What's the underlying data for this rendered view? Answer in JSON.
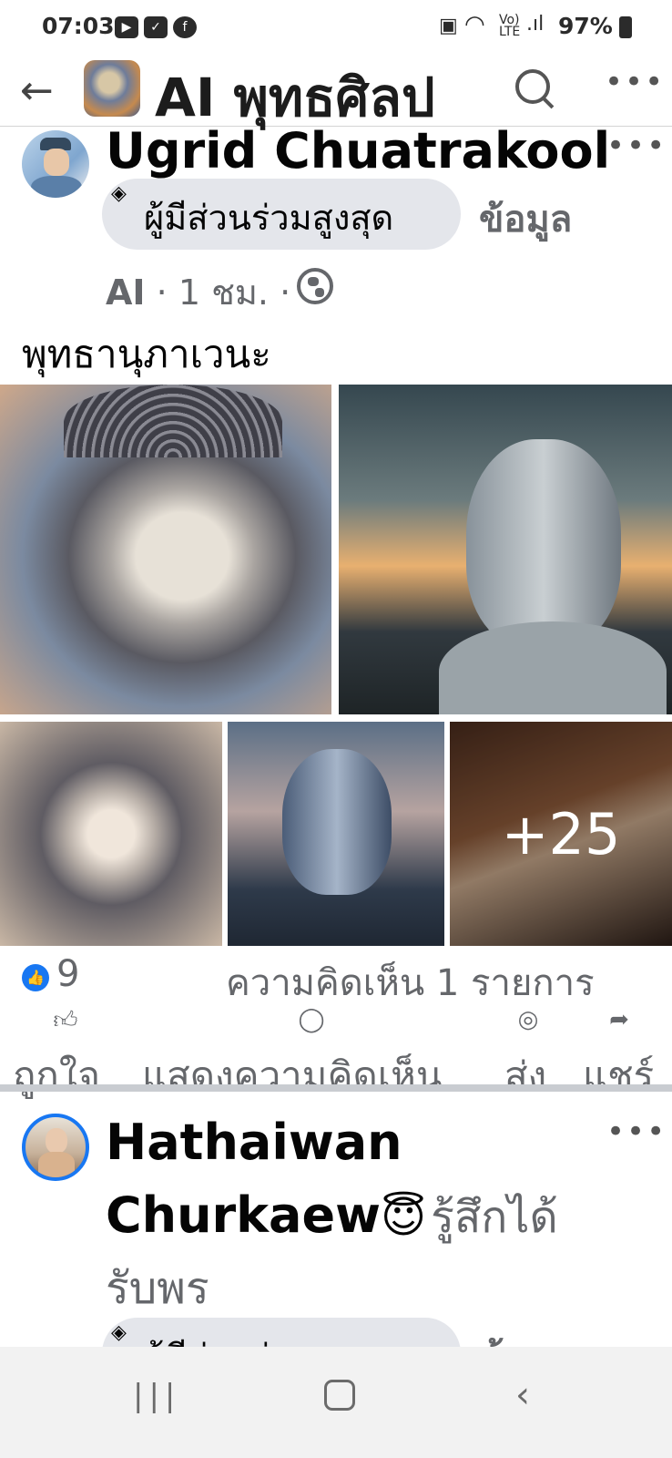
{
  "status_bar": {
    "time": "07:03",
    "battery": "97%"
  },
  "header": {
    "title": "AI พุทธศิลป"
  },
  "post1": {
    "author": "Ugrid Chuatrakool",
    "badge": "ผู้มีส่วนร่วมสูงสุด",
    "info_link": "ข้อมูล",
    "meta_tag": "AI",
    "meta_time": "1 ชม.",
    "caption": "พุทธานุภาเวนะ",
    "more_photos": "+25",
    "reactions_count": "9",
    "comments_count": "ความคิดเห็น 1 รายการ",
    "actions": {
      "like": "ถูกใจ",
      "comment": "แสดงความคิดเห็น",
      "send": "ส่ง",
      "share": "แชร์"
    }
  },
  "post2": {
    "author_line1": "Hathaiwan",
    "author_line2": "Churkaew",
    "emoji": "😇",
    "feeling": "รู้สึกได้",
    "feeling_line2": "รับพร",
    "badge": "ผู้มีส่วนร่วมสูงสุด",
    "info_link": "ข้อมูล"
  },
  "colors": {
    "accent": "#1877f2",
    "secondary_text": "#65676b",
    "badge_bg": "#e4e6eb"
  }
}
